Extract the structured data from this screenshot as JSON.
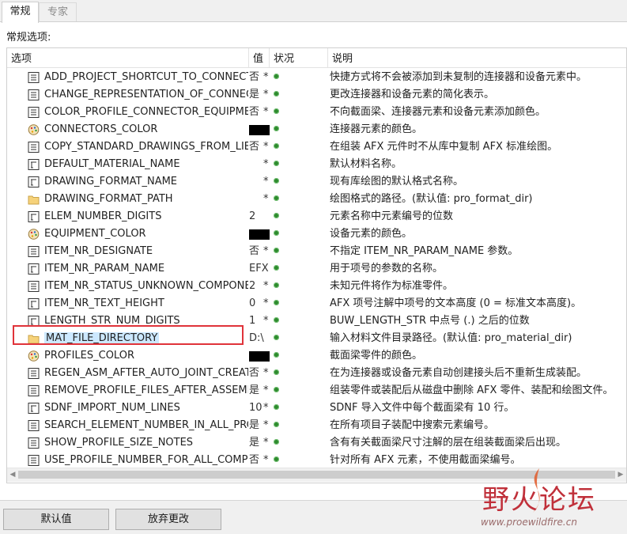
{
  "tabs": [
    {
      "label": "常规",
      "active": true
    },
    {
      "label": "专家",
      "active": false
    }
  ],
  "section_label": "常规选项:",
  "columns": {
    "option": "选项",
    "value": "值",
    "status": "状况",
    "description": "说明"
  },
  "rows": [
    {
      "name": "ADD_PROJECT_SHORTCUT_TO_CONNECT",
      "icon": "list-icon",
      "value": "否",
      "star": "*",
      "desc": "快捷方式将不会被添加到未复制的连接器和设备元素中。"
    },
    {
      "name": "CHANGE_REPRESENTATION_OF_CONNEC",
      "icon": "list-icon",
      "value": "是",
      "star": "*",
      "desc": "更改连接器和设备元素的简化表示。"
    },
    {
      "name": "COLOR_PROFILE_CONNECTOR_EQUIPME",
      "icon": "list-icon",
      "value": "否",
      "star": "*",
      "desc": "不向截面梁、连接器元素和设备元素添加颜色。"
    },
    {
      "name": "CONNECTORS_COLOR",
      "icon": "palette-icon",
      "value": "",
      "star": "",
      "swatch": "#000000",
      "desc": "连接器元素的颜色。"
    },
    {
      "name": "COPY_STANDARD_DRAWINGS_FROM_LIB",
      "icon": "list-icon",
      "value": "否",
      "star": "*",
      "desc": "在组装 AFX 元件时不从库中复制 AFX 标准绘图。"
    },
    {
      "name": "DEFAULT_MATERIAL_NAME",
      "icon": "text-field-icon",
      "value": "",
      "star": "*",
      "desc": "默认材料名称。"
    },
    {
      "name": "DRAWING_FORMAT_NAME",
      "icon": "text-field-icon",
      "value": "",
      "star": "*",
      "desc": "现有库绘图的默认格式名称。"
    },
    {
      "name": "DRAWING_FORMAT_PATH",
      "icon": "folder-icon",
      "value": "",
      "star": "*",
      "desc": "绘图格式的路径。(默认值: pro_format_dir)"
    },
    {
      "name": "ELEM_NUMBER_DIGITS",
      "icon": "text-field-icon",
      "value": "2",
      "star": "",
      "desc": "元素名称中元素编号的位数"
    },
    {
      "name": "EQUIPMENT_COLOR",
      "icon": "palette-icon",
      "value": "",
      "star": "",
      "swatch": "#000000",
      "desc": "设备元素的颜色。"
    },
    {
      "name": "ITEM_NR_DESIGNATE",
      "icon": "list-icon",
      "value": "否",
      "star": "*",
      "desc": "不指定 ITEM_NR_PARAM_NAME 参数。"
    },
    {
      "name": "ITEM_NR_PARAM_NAME",
      "icon": "text-field-icon",
      "value": "EFX",
      "star": "",
      "desc": "用于项号的参数的名称。"
    },
    {
      "name": "ITEM_NR_STATUS_UNKNOWN_COMPONE",
      "icon": "list-icon",
      "value": "2",
      "star": "*",
      "desc": "未知元件将作为标准零件。"
    },
    {
      "name": "ITEM_NR_TEXT_HEIGHT",
      "icon": "text-field-icon",
      "value": "0",
      "star": "*",
      "desc": "AFX 项号注解中项号的文本高度 (0 = 标准文本高度)。"
    },
    {
      "name": "LENGTH_STR_NUM_DIGITS",
      "icon": "text-field-icon",
      "value": "1",
      "star": "*",
      "desc": "BUW_LENGTH_STR 中点号 (.) 之后的位数"
    },
    {
      "name": "MAT_FILE_DIRECTORY",
      "icon": "folder-icon",
      "value": "D:\\",
      "star": "",
      "desc": "输入材料文件目录路径。(默认值: pro_material_dir)",
      "selected": true
    },
    {
      "name": "PROFILES_COLOR",
      "icon": "palette-icon",
      "value": "",
      "star": "",
      "swatch": "#000000",
      "desc": "截面梁零件的颜色。"
    },
    {
      "name": "REGEN_ASM_AFTER_AUTO_JOINT_CREATI",
      "icon": "list-icon",
      "value": "否",
      "star": "*",
      "desc": "在为连接器或设备元素自动创建接头后不重新生成装配。"
    },
    {
      "name": "REMOVE_PROFILE_FILES_AFTER_ASSEMBL",
      "icon": "list-icon",
      "value": "是",
      "star": "*",
      "desc": "组装零件或装配后从磁盘中删除 AFX 零件、装配和绘图文件。"
    },
    {
      "name": "SDNF_IMPORT_NUM_LINES",
      "icon": "text-field-icon",
      "value": "10",
      "star": "*",
      "desc": "SDNF 导入文件中每个截面梁有 10 行。"
    },
    {
      "name": "SEARCH_ELEMENT_NUMBER_IN_ALL_PRC",
      "icon": "list-icon",
      "value": "是",
      "star": "*",
      "desc": "在所有项目子装配中搜索元素编号。"
    },
    {
      "name": "SHOW_PROFILE_SIZE_NOTES",
      "icon": "list-icon",
      "value": "是",
      "star": "*",
      "desc": "含有有关截面梁尺寸注解的层在组装截面梁后出现。"
    },
    {
      "name": "USE_PROFILE_NUMBER_FOR_ALL_COMPC",
      "icon": "list-icon",
      "value": "否",
      "star": "*",
      "desc": "针对所有 AFX 元素，不使用截面梁编号。"
    }
  ],
  "buttons": {
    "default": "默认值",
    "discard": "放弃更改"
  },
  "watermark": {
    "text": "野火论坛",
    "url": "www.proewildfire.cn"
  },
  "colors": {
    "status_dot": "#2e8b2e",
    "highlight": "#e0333a",
    "selection": "#cce8ff"
  }
}
